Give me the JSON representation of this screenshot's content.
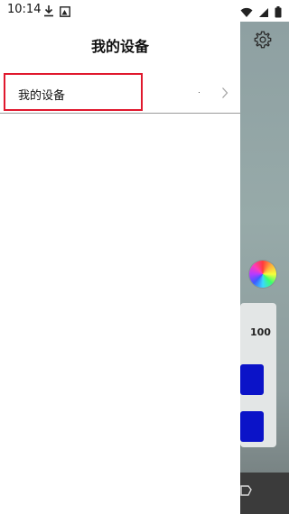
{
  "status_bar": {
    "time": "10:14"
  },
  "drawer": {
    "title": "我的设备",
    "items": [
      {
        "label": "我的设备"
      }
    ]
  },
  "background_app": {
    "value": "100",
    "accent": "#0b13c8"
  }
}
